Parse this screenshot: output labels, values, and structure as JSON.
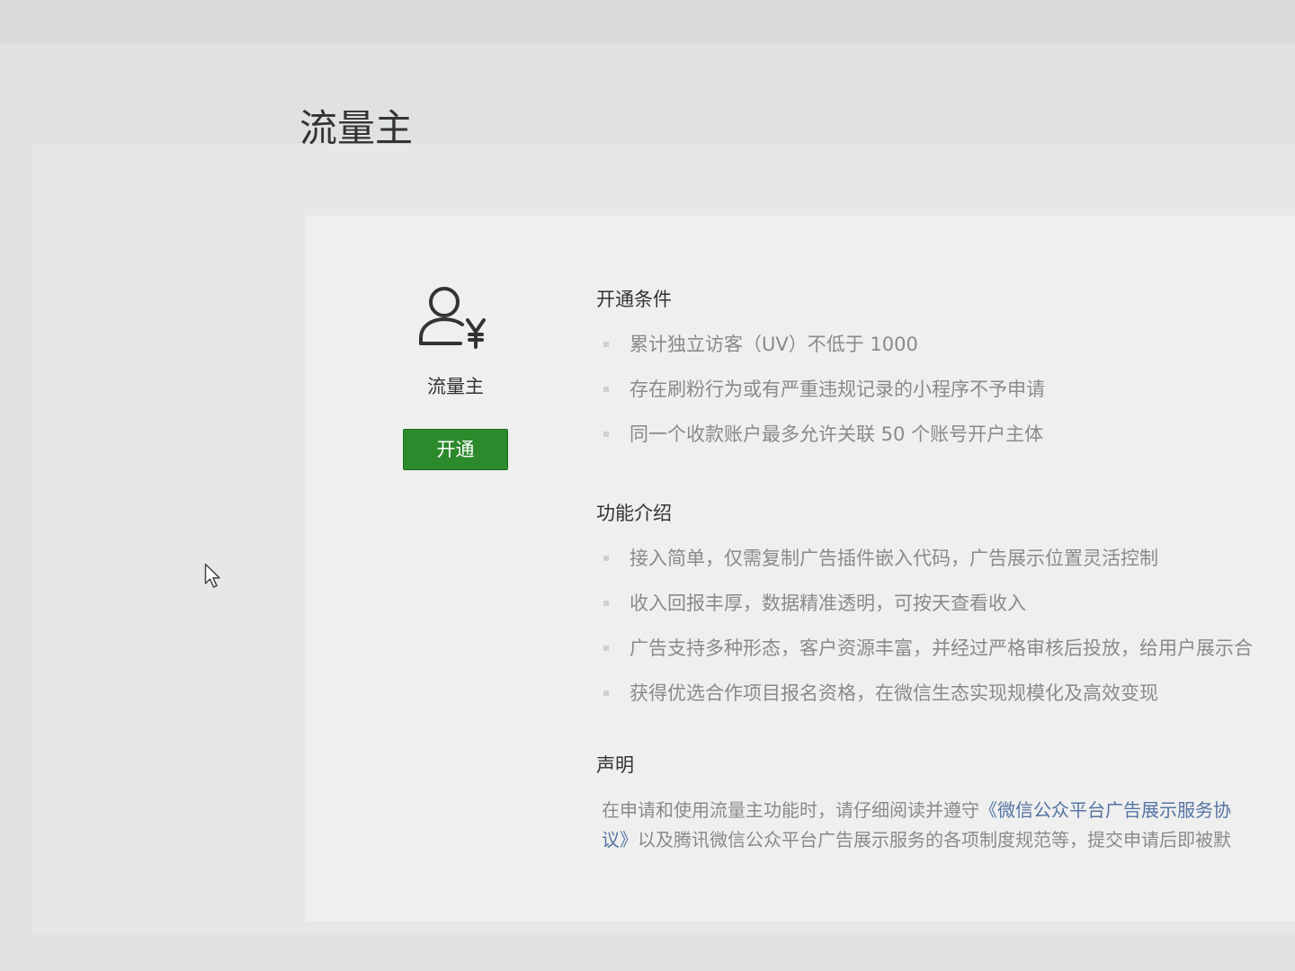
{
  "page": {
    "title": "流量主"
  },
  "service": {
    "icon": "user-yuan-icon",
    "name": "流量主",
    "action_label": "开通"
  },
  "sections": [
    {
      "heading": "开通条件",
      "items": [
        "累计独立访客（UV）不低于 1000",
        "存在刷粉行为或有严重违规记录的小程序不予申请",
        "同一个收款账户最多允许关联 50 个账号开户主体"
      ]
    },
    {
      "heading": "功能介绍",
      "items": [
        "接入简单，仅需复制广告插件嵌入代码，广告展示位置灵活控制",
        "收入回报丰厚，数据精准透明，可按天查看收入",
        "广告支持多种形态，客户资源丰富，并经过严格审核后投放，给用户展示合",
        "获得优选合作项目报名资格，在微信生态实现规模化及高效变现"
      ]
    }
  ],
  "declaration": {
    "heading": "声明",
    "line1_text": "在申请和使用流量主功能时，请仔细阅读并遵守",
    "line1_link": "《微信公众平台广告展示服务协",
    "line2_link": "议》",
    "line2_text": "以及腾讯微信公众平台广告展示服务的各项制度规范等，提交申请后即被默"
  },
  "cursor_icon": "mouse-cursor-icon",
  "colors": {
    "accent": "#2c8a2c",
    "link": "#5573a3",
    "text_primary": "#333333",
    "text_secondary": "#8a8a8a"
  }
}
